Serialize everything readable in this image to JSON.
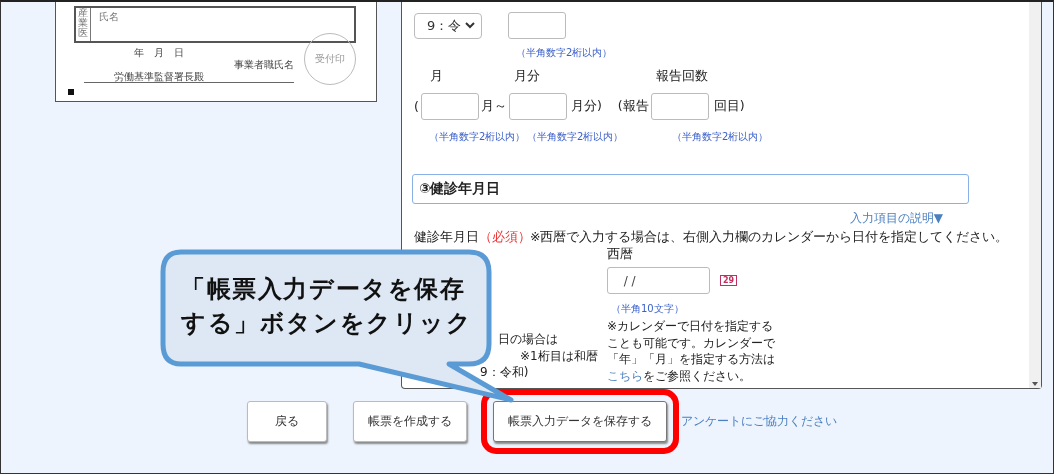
{
  "document_preview": {
    "side_label": "産業医",
    "name_label": "氏名",
    "date_label": "年　月　日",
    "employer_label": "事業者職氏名",
    "addressee": "労働基準監督署長殿",
    "stamp_label": "受付印"
  },
  "period_form": {
    "era_value": "9：令",
    "year_hint": "（半角数字2桁以内）",
    "month_label": "月",
    "month_end_label": "月分",
    "report_label": "報告回数",
    "open_paren": "(",
    "month_unit": "月～",
    "month_end_unit": "月分)",
    "report_prefix": "(報告",
    "report_suffix": "回目)",
    "hints": [
      "（半角数字2桁以内）",
      "（半角数字2桁以内）",
      "（半角数字2桁以内）"
    ]
  },
  "section": {
    "title": "③健診年月日",
    "help_link": "入力項目の説明▼",
    "field_label": "健診年月日",
    "required_mark": "（必須）",
    "note": "※西暦で入力する場合は、右側入力欄のカレンダーから日付を指定してください。",
    "left_fragments": [
      "日の場合は",
      "※1桁目は和暦",
      "9：令和)"
    ],
    "western_label": "西暦",
    "date_value": "  / /",
    "calendar_day": "29",
    "date_hint": "（半角10文字）",
    "calendar_note_before": "※カレンダーで日付を指定することも可能です。カレンダーで「年」「月」を指定する方法は",
    "calendar_note_link": "こちら",
    "calendar_note_after": "をご参照ください。"
  },
  "buttons": [
    {
      "label": "戻る",
      "highlighted": false
    },
    {
      "label": "帳票を作成する",
      "highlighted": false
    },
    {
      "label": "帳票入力データを保存する",
      "highlighted": true
    }
  ],
  "survey_link": "アンケートにご協力ください",
  "callout": {
    "text": "「帳票入力データを保存する」ボタンをクリック"
  }
}
